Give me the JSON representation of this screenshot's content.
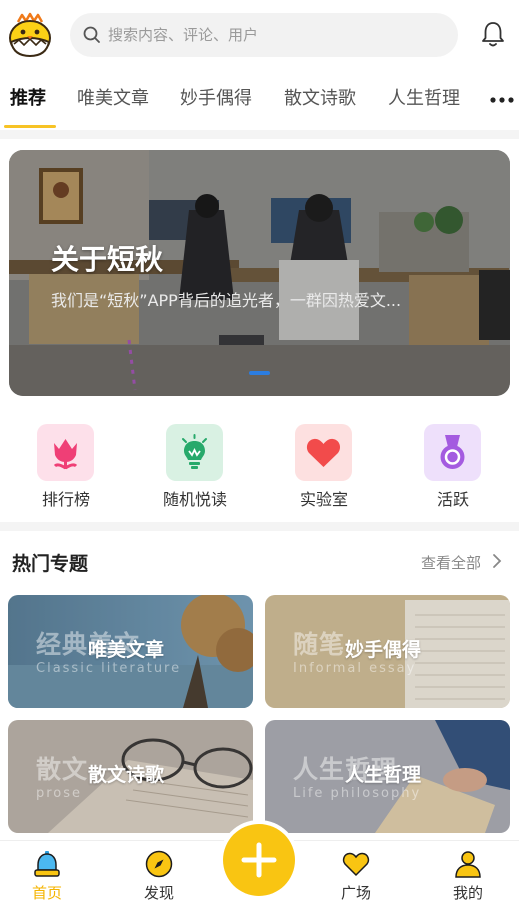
{
  "header": {
    "search_placeholder": "搜索内容、评论、用户",
    "icons": {
      "logo": "chick-logo-icon",
      "search": "search-icon",
      "notifications": "bell-icon"
    }
  },
  "tabs": [
    {
      "label": "推荐",
      "active": true
    },
    {
      "label": "唯美文章",
      "active": false
    },
    {
      "label": "妙手偶得",
      "active": false
    },
    {
      "label": "散文诗歌",
      "active": false
    },
    {
      "label": "人生哲理",
      "active": false
    }
  ],
  "more_icon": "more-dots-icon",
  "banner": {
    "title": "关于短秋",
    "description": "我们是“短秋”APP背后的追光者，一群因热爱文...",
    "active_slide": 1
  },
  "quick_menu": [
    {
      "label": "排行榜",
      "icon": "tulip-icon",
      "bg": "#fde0ea",
      "color": "#ef3f76"
    },
    {
      "label": "随机悦读",
      "icon": "lightbulb-icon",
      "bg": "#d9f1e3",
      "color": "#27a96b"
    },
    {
      "label": "实验室",
      "icon": "heart-icon",
      "bg": "#fde0e0",
      "color": "#f24b4b"
    },
    {
      "label": "活跃",
      "icon": "medal-icon",
      "bg": "#eee0fb",
      "color": "#a45be0"
    }
  ],
  "topics": {
    "title": "热门专题",
    "view_all": "查看全部",
    "cards": [
      {
        "title": "唯美文章",
        "watermark": "经典美文",
        "watermark_en": "Classic literature"
      },
      {
        "title": "妙手偶得",
        "watermark": "随笔",
        "watermark_en": "Informal essay"
      },
      {
        "title": "散文诗歌",
        "watermark": "散文",
        "watermark_en": "prose"
      },
      {
        "title": "人生哲理",
        "watermark": "人生哲理",
        "watermark_en": "Life philosophy"
      }
    ]
  },
  "bottom_nav": [
    {
      "label": "首页",
      "icon": "bell-home-icon",
      "active": true
    },
    {
      "label": "发现",
      "icon": "compass-icon",
      "active": false
    },
    {
      "label": "广场",
      "icon": "heart-outline-icon",
      "active": false
    },
    {
      "label": "我的",
      "icon": "user-icon",
      "active": false
    }
  ],
  "fab_icon": "plus-icon",
  "colors": {
    "accent": "#f9c512",
    "tab_underline": "#f7c325",
    "active_nav": "#f5b400",
    "banner_dot": "#2b7de1"
  }
}
